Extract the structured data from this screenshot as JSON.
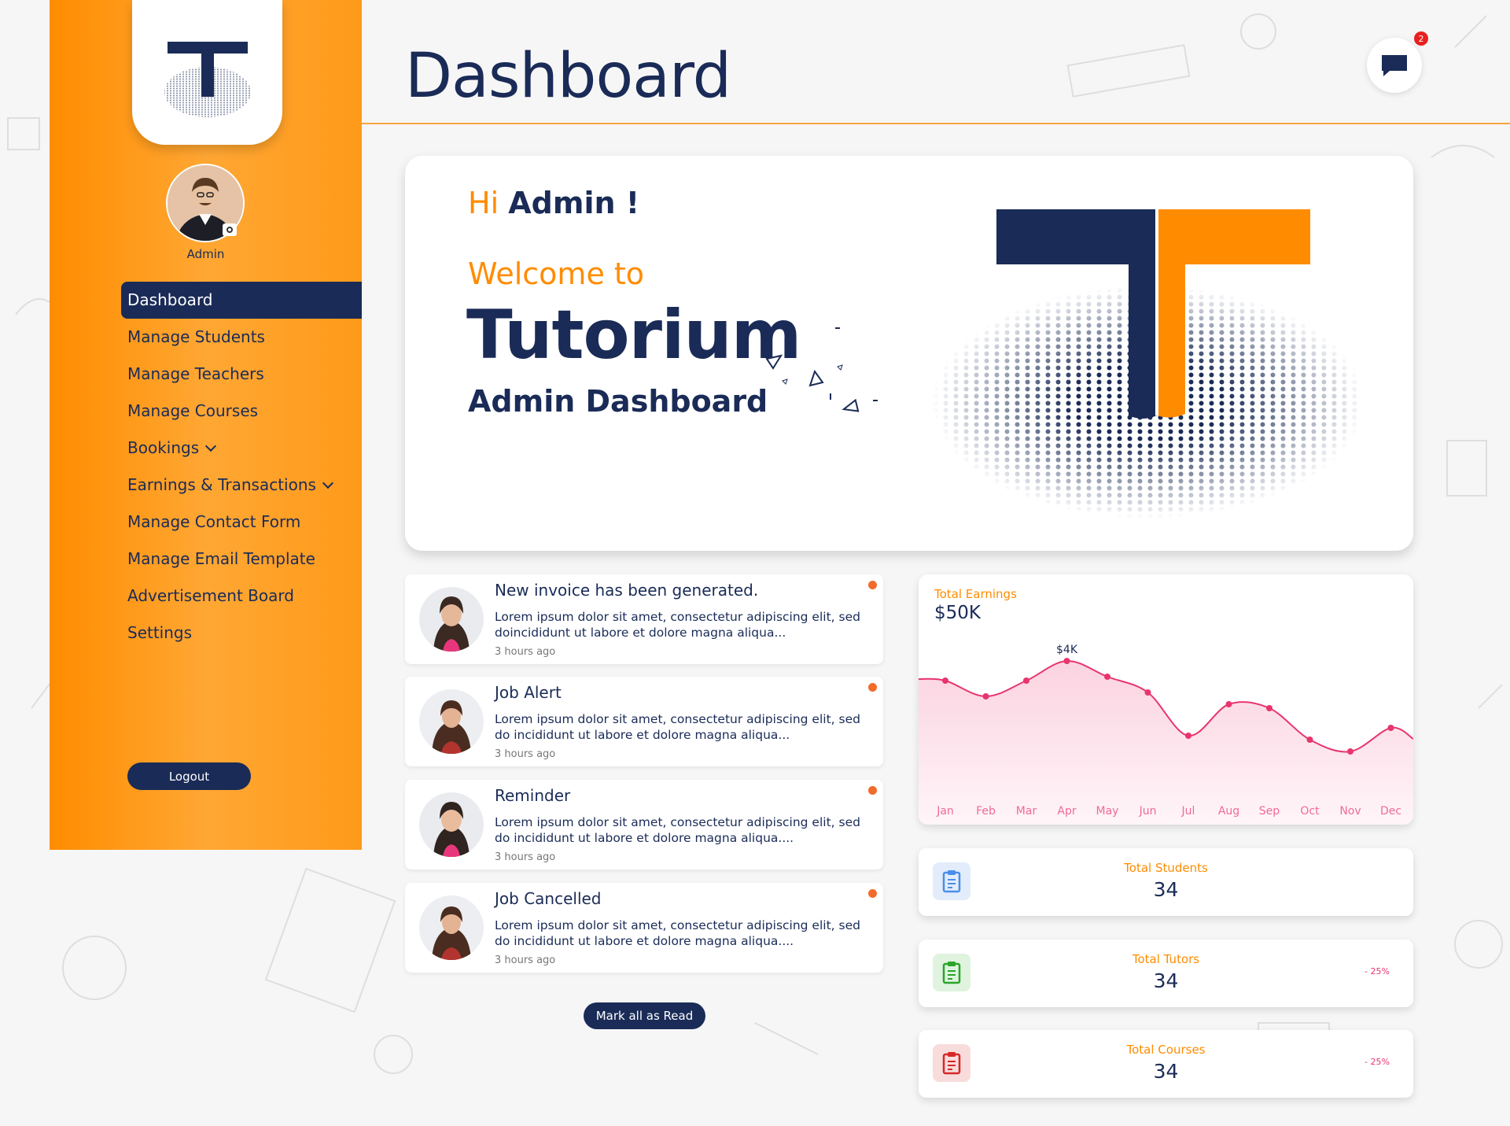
{
  "header": {
    "title": "Dashboard",
    "notification_count": "2"
  },
  "sidebar": {
    "user_name": "Admin",
    "items": [
      {
        "label": "Dashboard",
        "active": true
      },
      {
        "label": "Manage Students"
      },
      {
        "label": "Manage Teachers"
      },
      {
        "label": "Manage Courses"
      },
      {
        "label": "Bookings",
        "dropdown": true
      },
      {
        "label": "Earnings & Transactions",
        "dropdown": true
      },
      {
        "label": "Manage Contact Form"
      },
      {
        "label": "Manage Email Template"
      },
      {
        "label": "Advertisement Board"
      },
      {
        "label": "Settings"
      }
    ],
    "logout_label": "Logout"
  },
  "welcome": {
    "hi": "Hi",
    "name": "Admin !",
    "welcome_to": "Welcome to",
    "brand": "Tutorium",
    "subtitle": "Admin Dashboard"
  },
  "notifications": [
    {
      "title": "New invoice has been generated.",
      "body": "Lorem ipsum dolor sit amet, consectetur adipiscing elit, sed doincididunt ut labore et dolore magna aliqua...",
      "time": "3 hours ago"
    },
    {
      "title": "Job Alert",
      "body": "Lorem ipsum dolor sit amet, consectetur adipiscing elit, sed do incididunt ut labore et dolore magna aliqua...",
      "time": "3 hours ago"
    },
    {
      "title": "Reminder",
      "body": "Lorem ipsum dolor sit amet, consectetur adipiscing elit, sed do incididunt ut labore et dolore magna aliqua....",
      "time": "3 hours ago"
    },
    {
      "title": "Job Cancelled",
      "body": "Lorem ipsum dolor sit amet, consectetur adipiscing elit, sed do incididunt ut labore et dolore magna aliqua....",
      "time": "3 hours ago"
    }
  ],
  "mark_read_label": "Mark all as Read",
  "earnings": {
    "label": "Total Earnings",
    "value": "$50K",
    "peak_label": "$4K"
  },
  "chart_data": {
    "type": "area",
    "categories": [
      "Jan",
      "Feb",
      "Mar",
      "Apr",
      "May",
      "Jun",
      "Jul",
      "Aug",
      "Sep",
      "Oct",
      "Nov",
      "Dec"
    ],
    "values": [
      3.5,
      3.1,
      3.5,
      4.0,
      3.6,
      3.2,
      2.1,
      2.9,
      2.8,
      2.0,
      1.7,
      2.3
    ],
    "title": "",
    "annotations": [
      {
        "category": "Apr",
        "text": "$4K"
      }
    ],
    "colors": {
      "line": "#e8356e",
      "fill": "#fbd3e0",
      "tick": "#f06a99"
    }
  },
  "stats": [
    {
      "label": "Total Students",
      "value": "34",
      "delta": "",
      "icon": "clipboard-icon",
      "color": "#4a8fe8",
      "bg": "#e2ecfb"
    },
    {
      "label": "Total Tutors",
      "value": "34",
      "delta": "- 25%",
      "icon": "clipboard-icon",
      "color": "#2aa52a",
      "bg": "#dff3df"
    },
    {
      "label": "Total Courses",
      "value": "34",
      "delta": "- 25%",
      "icon": "clipboard-icon",
      "color": "#d62828",
      "bg": "#f8dcdc"
    }
  ]
}
